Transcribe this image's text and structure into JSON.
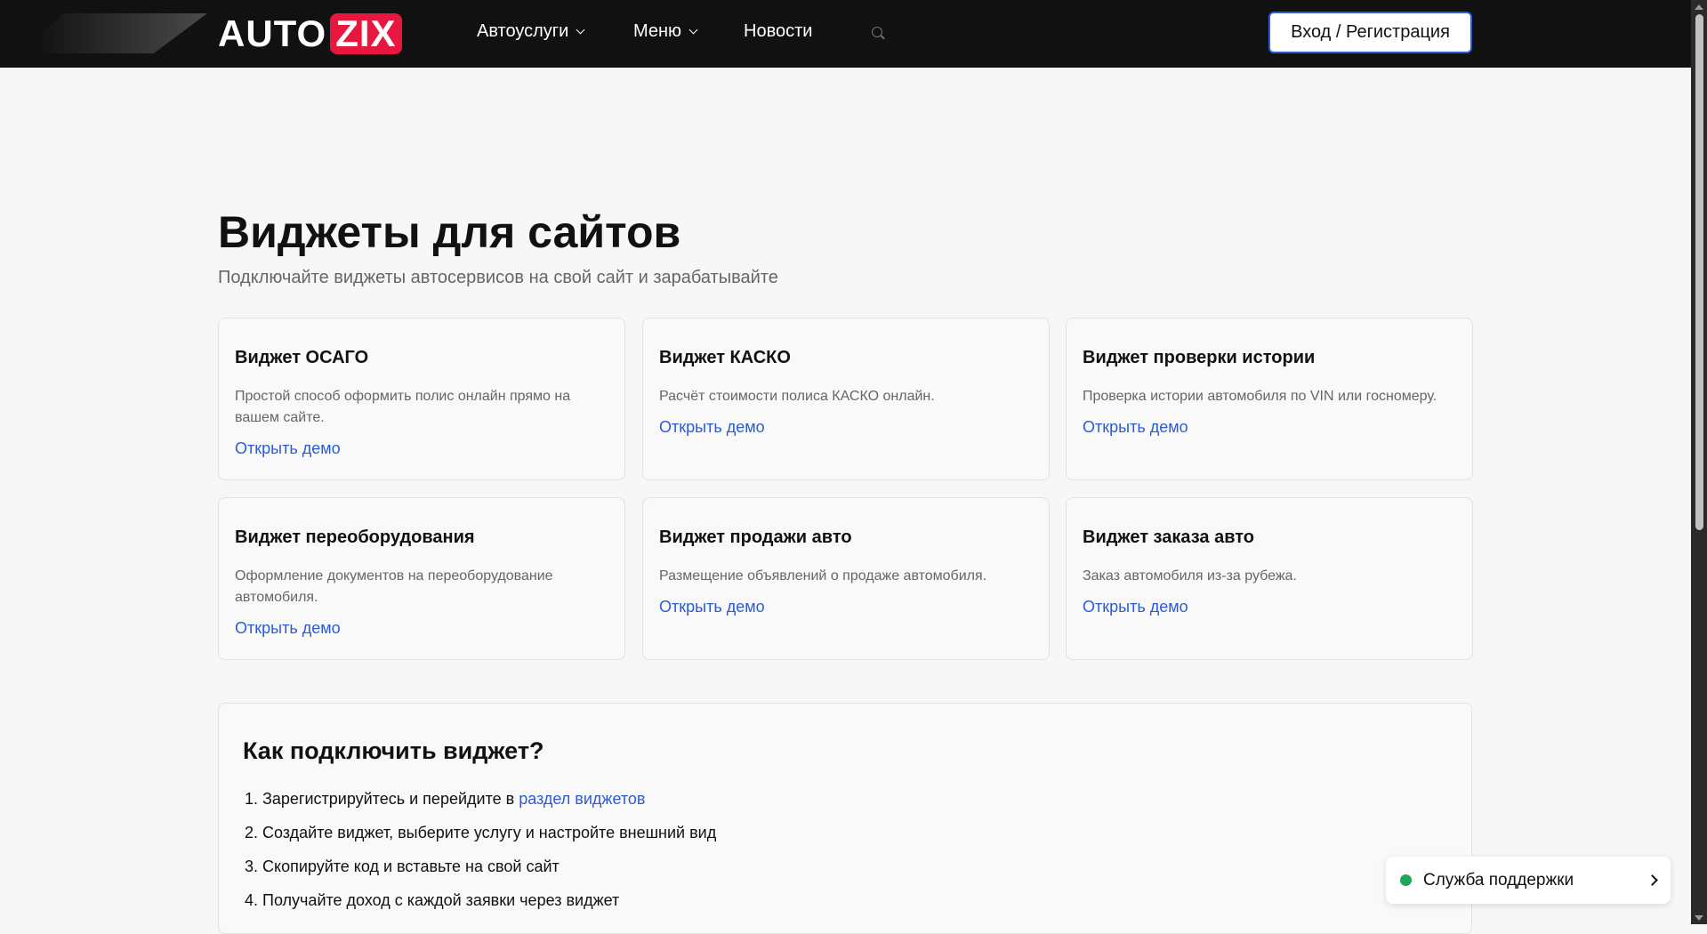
{
  "header": {
    "logo_auto": "AUTO",
    "logo_zix": "ZIX",
    "nav": [
      "Автоуслуги",
      "Меню",
      "Новости"
    ],
    "login": "Вход / Регистрация"
  },
  "page": {
    "title": "Виджеты для сайтов",
    "subtitle": "Подключайте виджеты автосервисов на свой сайт и зарабатывайте"
  },
  "cards": [
    {
      "title": "Виджет ОСАГО",
      "desc": "Простой способ оформить полис онлайн прямо на вашем сайте.",
      "link": "Открыть демо"
    },
    {
      "title": "Виджет КАСКО",
      "desc": "Расчёт стоимости полиса КАСКО онлайн.",
      "link": "Открыть демо"
    },
    {
      "title": "Виджет проверки истории",
      "desc": "Проверка истории автомобиля по VIN или госномеру.",
      "link": "Открыть демо"
    },
    {
      "title": "Виджет переоборудования",
      "desc": "Оформление документов на переоборудование автомобиля.",
      "link": "Открыть демо"
    },
    {
      "title": "Виджет продажи авто",
      "desc": "Размещение объявлений о продаже автомобиля.",
      "link": "Открыть демо"
    },
    {
      "title": "Виджет заказа авто",
      "desc": "Заказ автомобиля из-за рубежа.",
      "link": "Открыть демо"
    }
  ],
  "howto": {
    "title": "Как подключить виджет?",
    "step1_text": "Зарегистрируйтесь и перейдите в ",
    "step1_link": "раздел виджетов",
    "steps": [
      "Создайте виджет, выберите услугу и настройте внешний вид",
      "Скопируйте код и вставьте на свой сайт",
      "Получайте доход с каждой заявки через виджет"
    ]
  },
  "support": {
    "label": "Служба поддержки",
    "status_color": "#1fa65a"
  }
}
